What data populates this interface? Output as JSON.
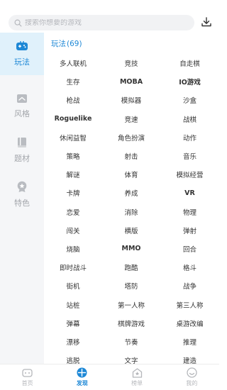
{
  "colors": {
    "accent": "#1e88d6",
    "sidebar_bg": "#f5f6f8",
    "active_bg": "#e0f1fb",
    "muted": "#a3a6ab"
  },
  "search": {
    "placeholder": "搜索你想要的游戏",
    "icon": "search-icon"
  },
  "header": {
    "download_icon": "download-icon"
  },
  "sidebar": {
    "items": [
      {
        "label": "玩法",
        "icon": "gamepad-icon",
        "active": true
      },
      {
        "label": "风格",
        "icon": "style-icon",
        "active": false
      },
      {
        "label": "题材",
        "icon": "book-icon",
        "active": false
      },
      {
        "label": "特色",
        "icon": "badge-icon",
        "active": false
      }
    ]
  },
  "section": {
    "title": "玩法",
    "count": "(69)"
  },
  "tags": [
    "多人联机",
    "竞技",
    "自走棋",
    "生存",
    "MOBA",
    "IO游戏",
    "枪战",
    "模拟器",
    "沙盒",
    "Roguelike",
    "竞速",
    "战棋",
    "休闲益智",
    "角色扮演",
    "动作",
    "策略",
    "射击",
    "音乐",
    "解谜",
    "体育",
    "模拟经营",
    "卡牌",
    "养成",
    "VR",
    "恋爱",
    "消除",
    "物理",
    "闯关",
    "横版",
    "弹射",
    "烧脑",
    "MMO",
    "回合",
    "即时战斗",
    "跑酷",
    "格斗",
    "街机",
    "塔防",
    "战争",
    "站桩",
    "第一人称",
    "第三人称",
    "弹幕",
    "棋牌游戏",
    "桌游改编",
    "漂移",
    "节奏",
    "推理",
    "逃脱",
    "文字",
    "建造"
  ],
  "bottom_nav": [
    {
      "label": "首页",
      "icon": "home-icon",
      "active": false
    },
    {
      "label": "发现",
      "icon": "discover-icon",
      "active": true
    },
    {
      "label": "榜单",
      "icon": "ranking-icon",
      "active": false
    },
    {
      "label": "我的",
      "icon": "profile-icon",
      "active": false
    }
  ]
}
